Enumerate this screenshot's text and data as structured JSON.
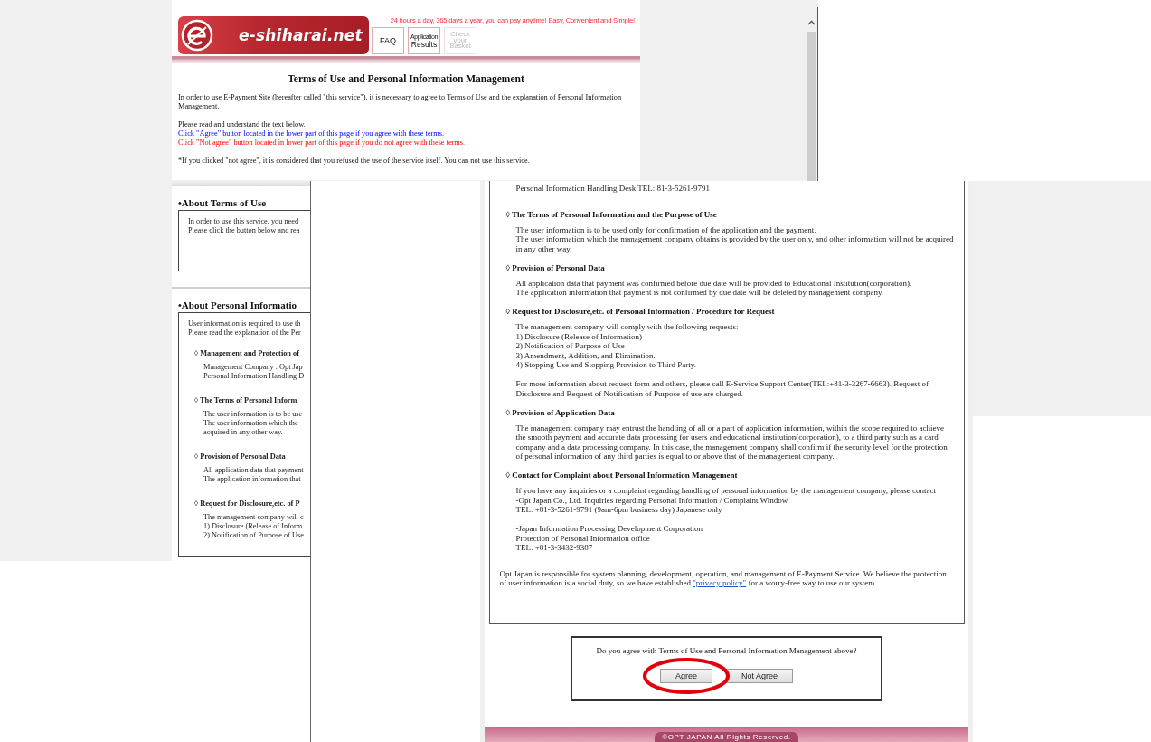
{
  "back_capture": {
    "header": {
      "logo": "e-shiharai.net",
      "tagline": "24 hours a day, 365 days a year, you can pay anytime! Easy, Convenient and Simple!",
      "nav": [
        {
          "lines": [
            "FAQ"
          ],
          "disabled": false
        },
        {
          "lines": [
            "Application",
            "Results"
          ],
          "disabled": false
        },
        {
          "lines": [
            "Check",
            "your",
            "Basket"
          ],
          "disabled": true
        }
      ]
    },
    "title": "Terms of Use and Personal Information Management",
    "intro": [
      [
        {
          "text": "In order to use E-Payment Site (hereafter called \"this service\"), it is necessary to agree to Terms of Use and the explanation of Personal Information Management.",
          "kind": "plain"
        }
      ],
      [
        {
          "text": "Please read and understand the text below.",
          "kind": "plain"
        },
        {
          "text": "Click \"Agree\" button located in the lower part of this page if you agree with these terms.",
          "kind": "agree"
        },
        {
          "text": "Click \"Not agree\" button located in lower part of this page if you do not agree with these terms.",
          "kind": "disagree"
        }
      ],
      [
        {
          "text": "*If you clicked \"not agree\", it is considered that you refused the use of the service itself. You can not use this service.",
          "kind": "plain"
        }
      ]
    ],
    "sections": [
      {
        "heading": "•About Terms of Use",
        "intro": [
          "In order to use this service, you need",
          "Please click the button below and rea"
        ]
      },
      {
        "heading": "•About Personal Informatio",
        "intro": [
          "User information is required to use th",
          "Please read the explanation of the Per"
        ],
        "items": [
          {
            "heading": "◊ Management and Protection of",
            "lines": [
              "Management Company : Opt Jap",
              "Personal Information Handling D"
            ]
          },
          {
            "heading": "◊ The Terms of Personal Inform",
            "lines": [
              "The user information is to be use",
              "The user information which the",
              "acquired in any other way."
            ]
          },
          {
            "heading": "◊ Provision of Personal Data",
            "lines": [
              "All application data that payment",
              "The application information that"
            ]
          },
          {
            "heading": "◊ Request for Disclosure,etc. of P",
            "lines": [
              "The management company will c",
              "1) Disclosure (Release of Inform",
              "2) Notification of Purpose of Use"
            ]
          }
        ]
      }
    ]
  },
  "front_capture": {
    "lines": [
      "Personal Information Handling Desk TEL: 81-3-5261-9791"
    ],
    "items": [
      {
        "heading": "◊ The Terms of Personal Information and the Purpose of Use",
        "blocks": [
          [
            "The user information is to be used only for confirmation of the application and the payment.",
            "The user information which the management company obtains is provided by the user only, and other information will not be acquired in any other way."
          ]
        ]
      },
      {
        "heading": "◊ Provision of Personal Data",
        "blocks": [
          [
            "All application data that payment was confirmed before due date will be provided to Educational Institution(corporation).",
            "The application information that payment is not confirmed by due date will be deleted by management company."
          ]
        ]
      },
      {
        "heading": "◊ Request for Disclosure,etc. of Personal Information / Procedure for Request",
        "blocks": [
          [
            "The management company will comply with the following requests:",
            "1) Disclosure (Release of Information)",
            "2) Notification of Purpose of Use",
            "3) Amendment, Addition, and Elimination.",
            "4) Stopping Use and Stopping Provision to Third Party."
          ],
          [
            "For more information about request form and others, please call E-Service Support Center(TEL:+81-3-3267-6663). Request of Disclosure and Request of Notification of Purpose of use are charged."
          ]
        ]
      },
      {
        "heading": "◊ Provision of Application Data",
        "blocks": [
          [
            "The management company may entrust the handling of all or a part of application information, within the scope required to achieve the smooth payment and accurate data processing for users and educational institution(corporation), to a third party such as a card company and a data processing company. In this case, the management company shall confirm if the security level for the protection of personal information of any third parties is equal to or above that of the management company."
          ]
        ]
      },
      {
        "heading": "◊ Contact for Complaint about Personal Information Management",
        "blocks": [
          [
            "If you have any inquiries or a complaint regarding handling of personal information by the management company, please contact :",
            "-Opt Japan Co., Ltd. Inquiries regarding Personal Information / Complaint Window",
            "TEL: +81-3-5261-9791 (9am-6pm business day) Japanese only"
          ],
          [
            "-Japan Information Processing Development Corporation",
            "Protection of Personal Information office",
            "TEL: +81-3-3432-9387"
          ]
        ]
      }
    ],
    "closing": {
      "before": "Opt Japan is responsible for system planning, development, operation, and management of E-Payment Service. We believe the protection of user information is a social duty, so we have established",
      "link": "\"privacy policy\"",
      "after": " for a worry-free way to use our system."
    },
    "question": "Do you agree with Terms of Use and Personal Information Management above?",
    "buttons": [
      {
        "label": "Agree",
        "highlighted": true
      },
      {
        "label": "Not Agree",
        "highlighted": false
      }
    ],
    "footer": "©OPT JAPAN All Rights Reserved."
  }
}
